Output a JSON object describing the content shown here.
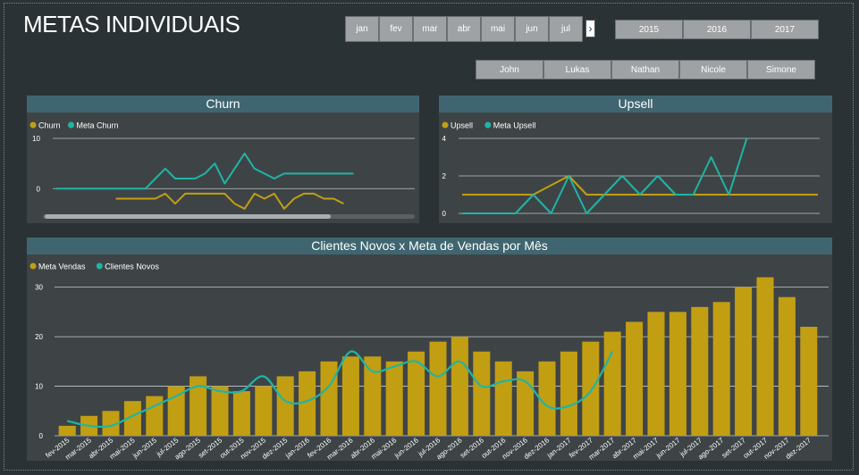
{
  "page": {
    "title": "METAS INDIVIDUAIS"
  },
  "filters": {
    "months": [
      "jan",
      "fev",
      "mar",
      "abr",
      "mai",
      "jun",
      "jul"
    ],
    "years": [
      "2015",
      "2016",
      "2017"
    ],
    "people": [
      "John",
      "Lukas",
      "Nathan",
      "Nicole",
      "Simone"
    ]
  },
  "colors": {
    "gold": "#c29e12",
    "teal": "#1fb5a5",
    "header": "#3f6670",
    "panel": "#3e4446"
  },
  "icons": {
    "next": "chevron-right-icon"
  },
  "chart_data": [
    {
      "type": "line",
      "title": "Churn",
      "x": [
        1,
        2,
        3,
        4,
        5,
        6,
        7,
        8,
        9,
        10,
        11,
        12,
        13,
        14,
        15,
        16,
        17,
        18,
        19,
        20,
        21,
        22,
        23,
        24,
        25,
        26,
        27,
        28,
        29,
        30,
        31,
        32,
        33,
        34,
        35,
        36,
        37
      ],
      "series": [
        {
          "name": "Churn",
          "color": "#c29e12",
          "values": [
            null,
            null,
            null,
            null,
            null,
            null,
            -2,
            -2,
            -2,
            -2,
            -2,
            -1,
            -3,
            -1,
            -1,
            -1,
            -1,
            -1,
            -3,
            -4,
            -1,
            -2,
            -1,
            -4,
            -2,
            -1,
            -1,
            -2,
            -2,
            -3,
            null,
            null,
            null,
            null,
            null,
            null,
            null
          ]
        },
        {
          "name": "Meta Churn",
          "color": "#1fb5a5",
          "values": [
            0,
            0,
            0,
            0,
            0,
            0,
            0,
            0,
            0,
            0,
            2,
            4,
            2,
            2,
            2,
            3,
            5,
            1,
            4,
            7,
            4,
            3,
            2,
            3,
            3,
            3,
            3,
            3,
            3,
            3,
            3,
            null,
            null,
            null,
            null,
            null,
            null
          ]
        }
      ],
      "yticks": [
        0,
        10
      ],
      "ylim": [
        -6,
        10
      ],
      "legend": "top-left",
      "grid": true,
      "scrollbar": true
    },
    {
      "type": "line",
      "title": "Upsell",
      "x": [
        1,
        2,
        3,
        4,
        5,
        6,
        7,
        8,
        9,
        10,
        11,
        12,
        13,
        14,
        15,
        16,
        17,
        18,
        19,
        20,
        21
      ],
      "series": [
        {
          "name": "Upsell",
          "color": "#c29e12",
          "values": [
            1,
            1,
            1,
            1,
            1,
            1.5,
            2,
            1,
            1,
            1,
            1,
            1,
            1,
            1,
            1,
            1,
            1,
            1,
            1,
            1,
            1
          ]
        },
        {
          "name": "Meta Upsell",
          "color": "#1fb5a5",
          "values": [
            0,
            0,
            0,
            0,
            1,
            0,
            2,
            0,
            1,
            2,
            1,
            2,
            1,
            1,
            3,
            1,
            4,
            null,
            null,
            null,
            null
          ]
        }
      ],
      "yticks": [
        0,
        2,
        4
      ],
      "ylim": [
        0,
        4
      ],
      "legend": "top-left",
      "grid": true
    },
    {
      "type": "bar",
      "title": "Clientes Novos x Meta de Vendas por Mês",
      "categories": [
        "fev-2015",
        "mar-2015",
        "abr-2015",
        "mai-2015",
        "jun-2015",
        "jul-2015",
        "ago-2015",
        "set-2015",
        "out-2015",
        "nov-2015",
        "dez-2015",
        "jan-2016",
        "fev-2016",
        "mar-2016",
        "abr-2016",
        "mai-2016",
        "jun-2016",
        "jul-2016",
        "ago-2016",
        "set-2016",
        "out-2016",
        "nov-2016",
        "dez-2016",
        "jan-2017",
        "fev-2017",
        "mar-2017",
        "abr-2017",
        "mai-2017",
        "jun-2017",
        "jul-2017",
        "ago-2017",
        "set-2017",
        "out-2017",
        "nov-2017",
        "dez-2017"
      ],
      "series": [
        {
          "name": "Meta Vendas",
          "type": "bar",
          "color": "#c29e12",
          "values": [
            2,
            4,
            5,
            7,
            8,
            10,
            12,
            10,
            9,
            10,
            12,
            13,
            15,
            16,
            16,
            15,
            17,
            19,
            20,
            17,
            15,
            13,
            15,
            17,
            19,
            21,
            23,
            25,
            25,
            26,
            27,
            30,
            32,
            28,
            22
          ]
        },
        {
          "name": "Clientes Novos",
          "type": "line",
          "color": "#1fb5a5",
          "values": [
            3,
            2,
            2,
            4,
            6,
            8,
            10,
            9,
            9,
            12,
            7,
            7,
            10,
            17,
            13,
            14,
            15,
            12,
            15,
            10,
            11,
            11,
            6,
            6,
            9,
            17,
            null,
            null,
            null,
            null,
            null,
            null,
            null,
            null,
            null
          ]
        }
      ],
      "yticks": [
        0,
        10,
        20,
        30
      ],
      "ylim": [
        0,
        33
      ],
      "legend": "top-left",
      "grid": true
    }
  ]
}
